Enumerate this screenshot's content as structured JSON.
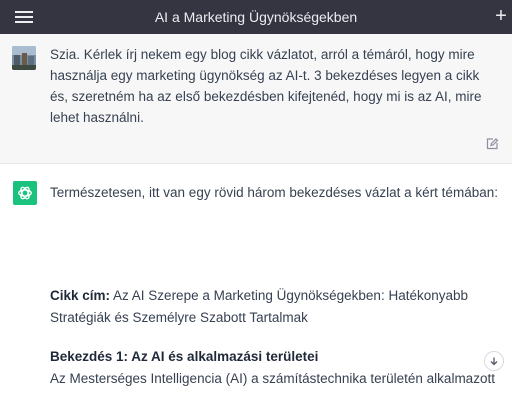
{
  "header": {
    "title": "AI a Marketing Ügynökségekben",
    "menu_icon": "hamburger-menu-icon",
    "new_chat_icon": "plus-icon"
  },
  "user_message": {
    "text": "Szia. Kérlek írj nekem egy blog cikk vázlatot, arról a témáról, hogy mire használja egy marketing ügynökség az AI-t. 3 bekezdéses legyen a cikk és, szeretném ha az első bekezdésben kifejtenéd, hogy mi is az AI, mire lehet használni.",
    "edit_icon": "edit-icon"
  },
  "assistant_message": {
    "intro": "Természetesen, itt van egy rövid három bekezdéses vázlat a kért témában:",
    "title_label": "Cikk cím:",
    "title_text": " Az AI Szerepe a Marketing Ügynökségekben: Hatékonyabb Stratégiák és Személyre Szabott Tartalmak",
    "para1_heading": "Bekezdés 1: Az AI és alkalmazási területei",
    "para1_text": "Az Mesterséges Intelligencia (AI) a számítástechnika területén alkalmazott"
  },
  "colors": {
    "header_bg": "#343541",
    "user_bg": "#f7f7f8",
    "assistant_avatar": "#19c37d"
  }
}
